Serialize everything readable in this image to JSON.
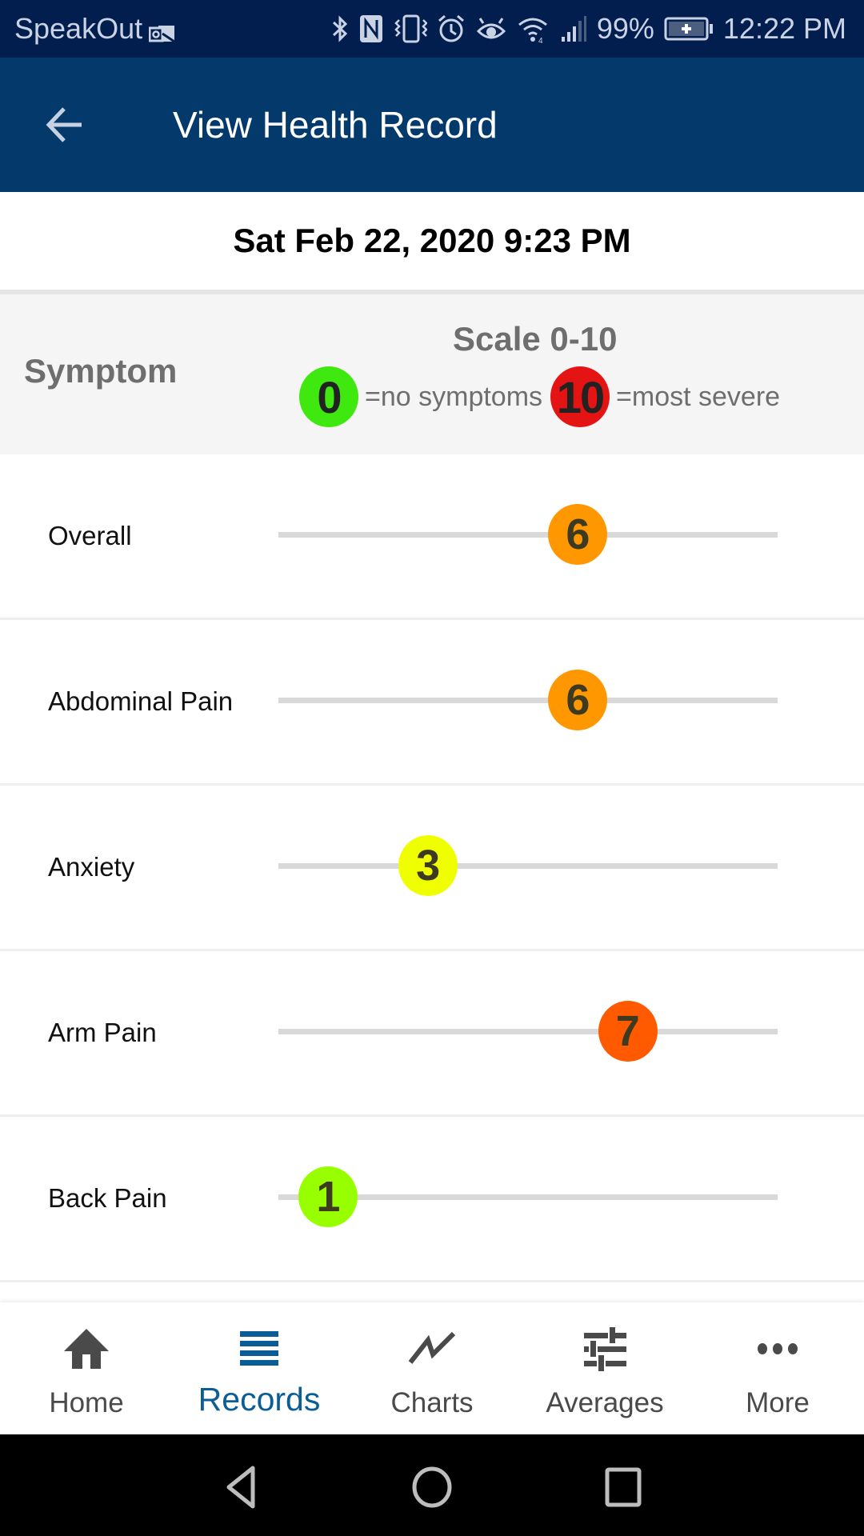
{
  "status_bar": {
    "app_name": "SpeakOut",
    "battery": "99%",
    "time": "12:22 PM",
    "icons": [
      "outlook-notification-icon",
      "bluetooth-icon",
      "nfc-icon",
      "vibrate-icon",
      "alarm-icon",
      "eye-comfort-icon",
      "wifi-icon",
      "signal-icon",
      "battery-charging-icon"
    ]
  },
  "app_bar": {
    "back_icon": "arrow-left-icon",
    "title": "View Health Record"
  },
  "record": {
    "datetime": "Sat Feb 22, 2020 9:23 PM"
  },
  "scale_header": {
    "symptom_heading": "Symptom",
    "scale_title": "Scale 0-10",
    "min_value": "0",
    "min_label": "=no symptoms",
    "min_color": "#3fe80f",
    "max_value": "10",
    "max_label": "=most severe",
    "max_color": "#e51414"
  },
  "scale": {
    "min": 0,
    "max": 10
  },
  "symptoms": [
    {
      "label": "Overall",
      "value": 6,
      "value_text": "6",
      "color": "#ff9800"
    },
    {
      "label": "Abdominal Pain",
      "value": 6,
      "value_text": "6",
      "color": "#ff9800"
    },
    {
      "label": "Anxiety",
      "value": 3,
      "value_text": "3",
      "color": "#f0ff00"
    },
    {
      "label": "Arm Pain",
      "value": 7,
      "value_text": "7",
      "color": "#ff5a00"
    },
    {
      "label": "Back Pain",
      "value": 1,
      "value_text": "1",
      "color": "#98ff00"
    }
  ],
  "bottom_nav": {
    "active": "Records",
    "items": [
      {
        "label": "Home",
        "icon": "home-icon"
      },
      {
        "label": "Records",
        "icon": "list-icon"
      },
      {
        "label": "Charts",
        "icon": "chart-line-icon"
      },
      {
        "label": "Averages",
        "icon": "sliders-icon"
      },
      {
        "label": "More",
        "icon": "more-dots-icon"
      }
    ]
  },
  "colors": {
    "status_bar": "#021e4f",
    "app_bar": "#043a6b",
    "active_nav": "#0b5d96"
  }
}
